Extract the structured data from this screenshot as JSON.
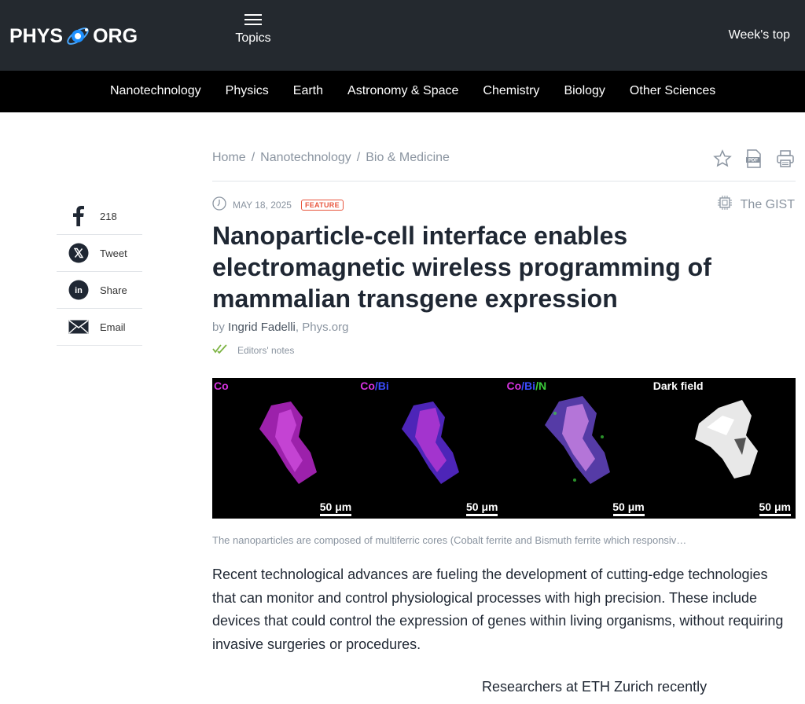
{
  "header": {
    "logo_left": "PHYS",
    "logo_right": "ORG",
    "topics_label": "Topics",
    "weeks_top_label": "Week's top"
  },
  "nav": {
    "items": [
      "Nanotechnology",
      "Physics",
      "Earth",
      "Astronomy & Space",
      "Chemistry",
      "Biology",
      "Other Sciences"
    ]
  },
  "share": {
    "facebook_count": "218",
    "tweet_label": "Tweet",
    "linkedin_label": "Share",
    "email_label": "Email"
  },
  "breadcrumb": {
    "home": "Home",
    "section": "Nanotechnology",
    "subsection": "Bio & Medicine",
    "separator": "/"
  },
  "article": {
    "date": "MAY 18, 2025",
    "badge": "FEATURE",
    "gist_label": "The GIST",
    "title": "Nanoparticle-cell interface enables electromagnetic wireless programming of mammalian transgene expression",
    "by": "by",
    "author": "Ingrid Fadelli",
    "source": ", Phys.org",
    "editors_notes": "Editors' notes",
    "caption": "The nanoparticles are composed of multiferric cores (Cobalt ferrite and Bismuth ferrite which responsiv…",
    "paragraph_1": "Recent technological advances are fueling the development of cutting-edge technologies that can monitor and control physiological processes with high precision. These include devices that could control the expression of genes within living organisms, without requiring invasive surgeries or procedures.",
    "paragraph_2": "Researchers at ETH Zurich recently"
  },
  "figure": {
    "panels": [
      {
        "label": "Co",
        "label_color": "#d633e0",
        "scale": "50 μm"
      },
      {
        "label_a": "Co",
        "label_b": "/Bi",
        "label_color_a": "#d633e0",
        "label_color_b": "#3b4cff",
        "scale": "50 μm"
      },
      {
        "label_a": "Co",
        "label_b": "/Bi",
        "label_c": "/N",
        "label_color_a": "#d633e0",
        "label_color_b": "#3b4cff",
        "label_color_c": "#3ccf3c",
        "scale": "50 μm"
      },
      {
        "label": "Dark field",
        "label_color": "#ffffff",
        "scale": "50 μm"
      }
    ]
  },
  "colors": {
    "header_bg": "#24292f",
    "nav_bg": "#000000",
    "accent_feature": "#e8553d",
    "logo_orb": "#1e90ff",
    "editors_check": "#7cb342"
  }
}
